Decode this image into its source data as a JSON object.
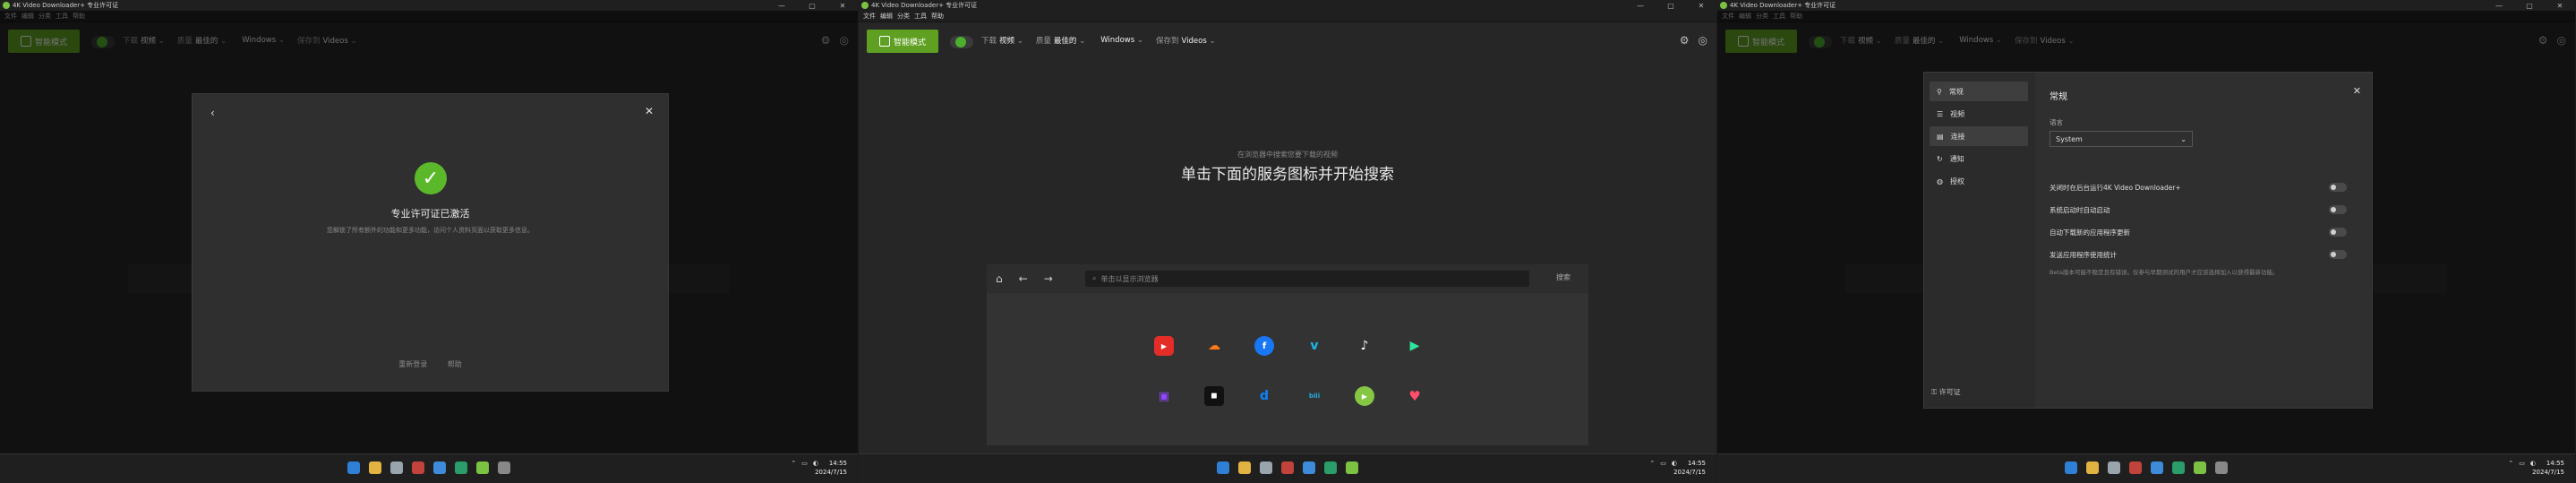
{
  "window_title": "4K Video Downloader+ 专业许可证",
  "window_controls": [
    "—",
    "▢",
    "✕"
  ],
  "menu": [
    "文件",
    "编辑",
    "分类",
    "工具",
    "帮助"
  ],
  "toolbar": {
    "smart_mode": "智能模式",
    "download_label": "下载",
    "download_value": "视频",
    "quality_label": "质量",
    "quality_value": "最佳的",
    "os_value": "Windows",
    "saveto_label": "保存到",
    "saveto_value": "Videos"
  },
  "activation_dialog": {
    "title": "专业许可证已激活",
    "description": "您解锁了所有额外的功能和更多功能，访问个人资料页面以获取更多信息。",
    "btn_primary": "重新登录",
    "btn_secondary": "帮助"
  },
  "search_page": {
    "hint_small": "在浏览器中搜索您要下载的视频",
    "hint_large": "单击下面的服务图标并开始搜索",
    "url_placeholder": "单击以显示浏览器",
    "search_label": "搜索"
  },
  "settings": {
    "title": "常规",
    "nav": [
      "常规",
      "视频",
      "连接",
      "通知",
      "授权"
    ],
    "sub_link": "许可证",
    "language_label": "语言",
    "language_value": "System",
    "options": [
      "关闭时在后台运行4K Video Downloader+",
      "系统启动时自动启动",
      "自动下载新的应用程序更新",
      "发送应用程序使用统计"
    ],
    "note": "Beta版本可能不稳定且有错误。仅参与早期测试的用户才应该选择加入以获得最新功能。"
  },
  "taskbar": {
    "time": "14:55",
    "date": "2024/7/15"
  },
  "colors": {
    "accent_green": "#5fa022",
    "success_green": "#5cb82b",
    "dark_bg": "#262626"
  }
}
